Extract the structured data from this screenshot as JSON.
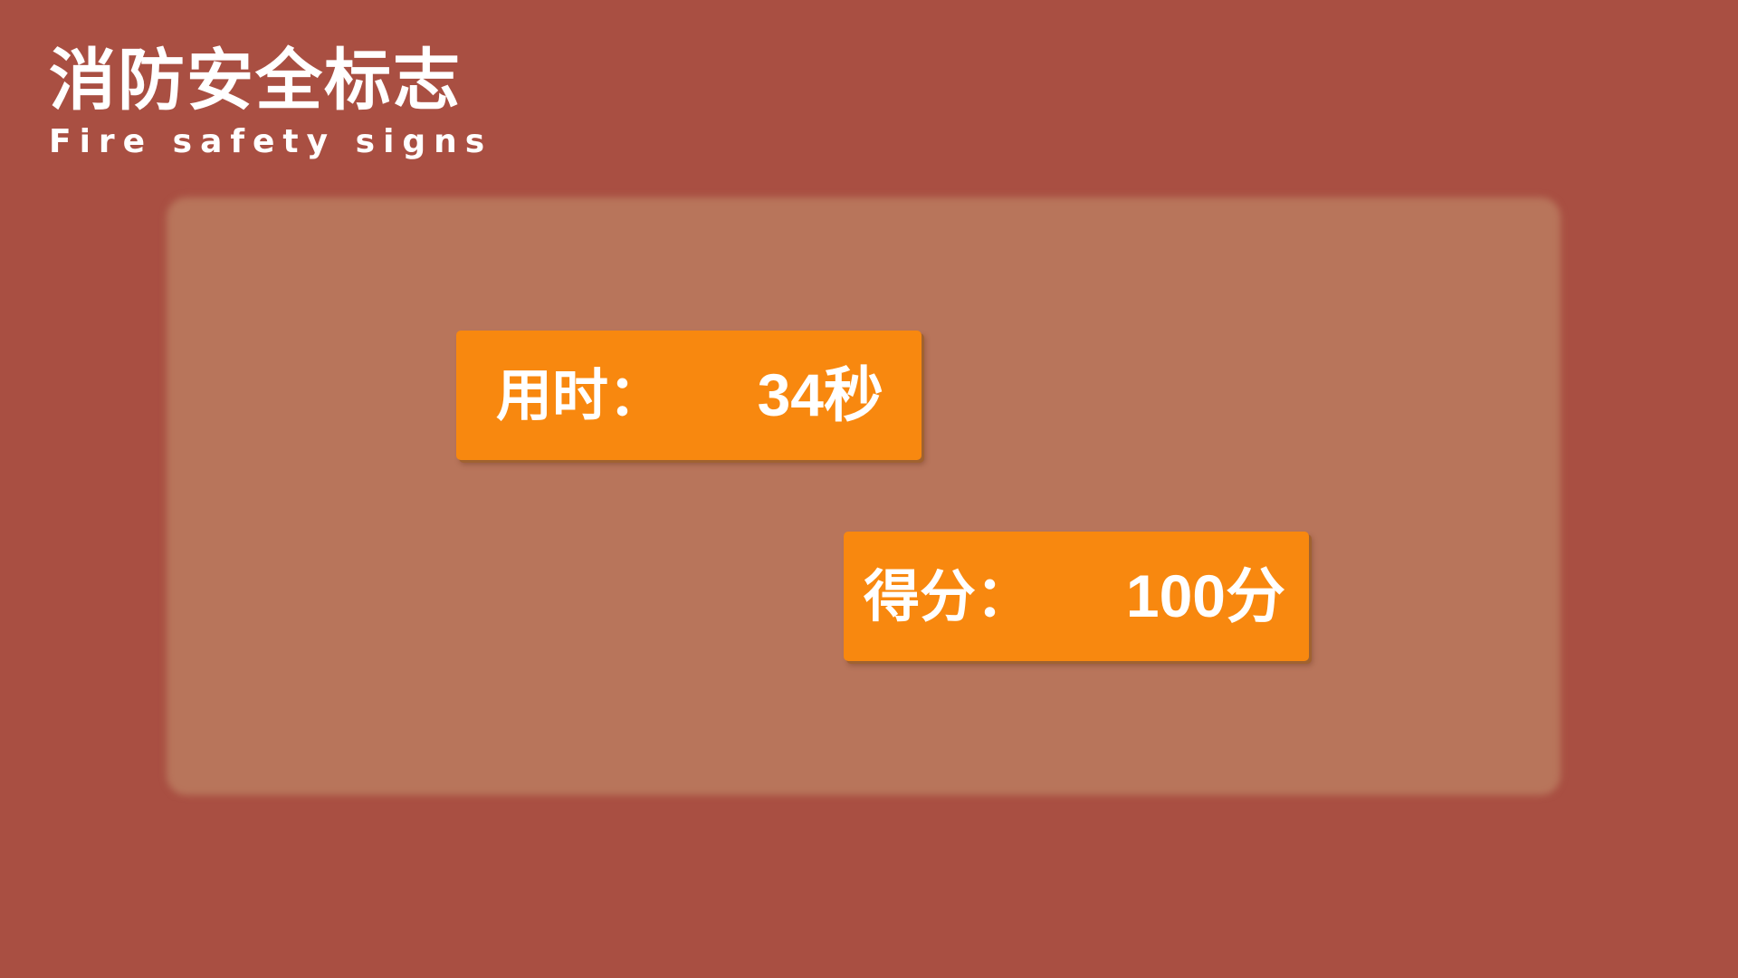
{
  "header": {
    "title_cn": "消防安全标志",
    "title_en": "Fire safety signs"
  },
  "results": {
    "time": {
      "label": "用时：",
      "value": "34秒"
    },
    "score": {
      "label": "得分：",
      "value": "100分"
    }
  },
  "colors": {
    "background": "#a94f42",
    "panel": "#b8755b",
    "box": "#f8880f",
    "text": "#ffffff"
  }
}
